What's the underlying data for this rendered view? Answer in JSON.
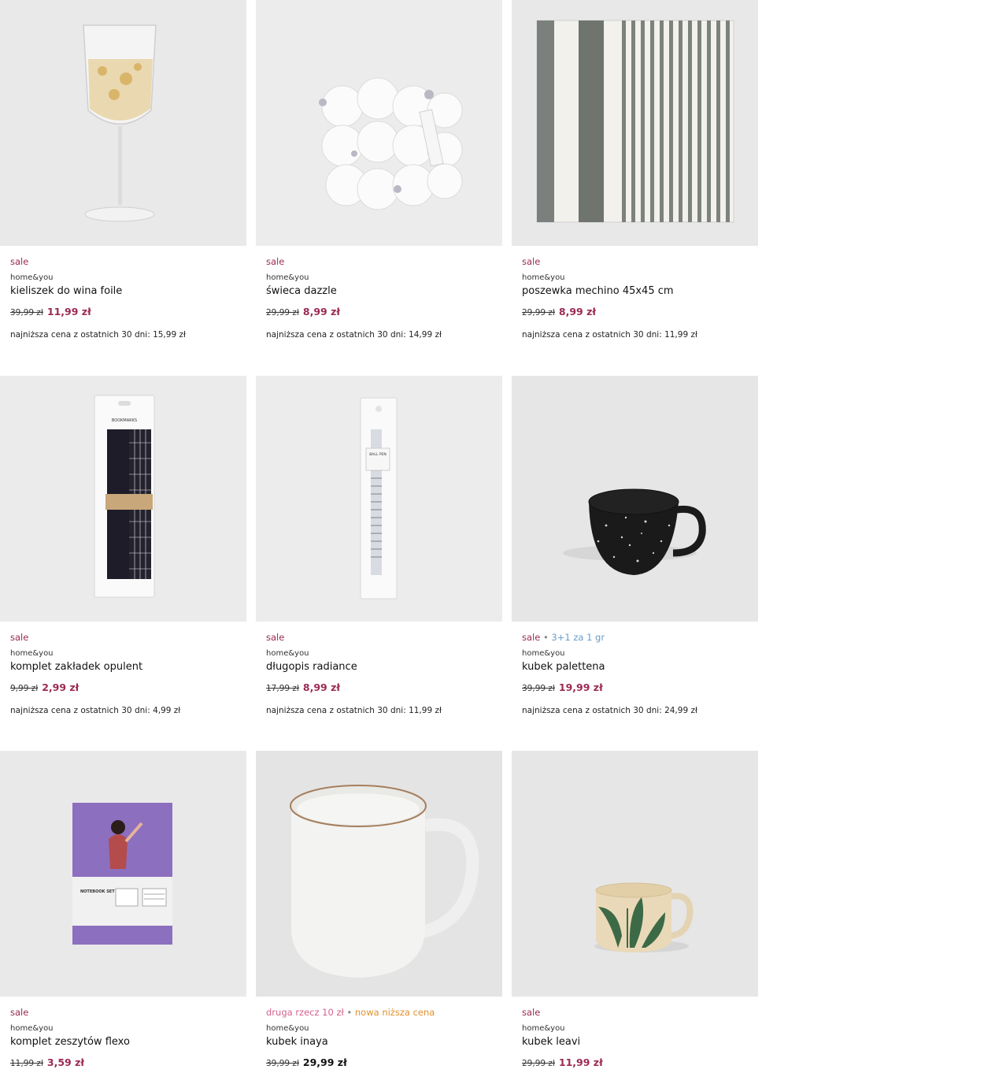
{
  "colors": {
    "sale": "#9b2a54",
    "blue_tag": "#6a9ec9",
    "pink_tag": "#d4628e",
    "orange_tag": "#e0902e",
    "image_bg": "#e9e9e9"
  },
  "products": [
    {
      "tags": [
        "sale"
      ],
      "brand": "home&you",
      "name": "kieliszek do wina foile",
      "old_price": "39,99 zł",
      "price": "11,99 zł",
      "lowest": "najniższa cena z ostatnich 30 dni: 15,99 zł",
      "icon": "wine-glass-image"
    },
    {
      "tags": [
        "sale"
      ],
      "brand": "home&you",
      "name": "świeca dazzle",
      "old_price": "29,99 zł",
      "price": "8,99 zł",
      "lowest": "najniższa cena z ostatnich 30 dni: 14,99 zł",
      "icon": "candle-image"
    },
    {
      "tags": [
        "sale"
      ],
      "brand": "home&you",
      "name": "poszewka mechino 45x45 cm",
      "old_price": "29,99 zł",
      "price": "8,99 zł",
      "lowest": "najniższa cena z ostatnich 30 dni: 11,99 zł",
      "icon": "pillowcase-image"
    },
    {
      "tags": [
        "sale"
      ],
      "brand": "home&you",
      "name": "komplet zakładek opulent",
      "old_price": "9,99 zł",
      "price": "2,99 zł",
      "lowest": "najniższa cena z ostatnich 30 dni: 4,99 zł",
      "icon": "bookmarks-image",
      "package_label": "BOOKMARKS"
    },
    {
      "tags": [
        "sale"
      ],
      "brand": "home&you",
      "name": "długopis radiance",
      "old_price": "17,99 zł",
      "price": "8,99 zł",
      "lowest": "najniższa cena z ostatnich 30 dni: 11,99 zł",
      "icon": "pen-image",
      "package_label": "BALL PEN"
    },
    {
      "tags": [
        "sale",
        "3+1 za 1 gr"
      ],
      "brand": "home&you",
      "name": "kubek palettena",
      "old_price": "39,99 zł",
      "price": "19,99 zł",
      "lowest": "najniższa cena z ostatnich 30 dni: 24,99 zł",
      "icon": "black-mug-image"
    },
    {
      "tags": [
        "sale"
      ],
      "brand": "home&you",
      "name": "komplet zeszytów flexo",
      "old_price": "11,99 zł",
      "price": "3,59 zł",
      "icon": "notebook-image",
      "package_label": "NOTEBOOK SET"
    },
    {
      "tags": [
        "druga rzecz 10 zł",
        "nowa niższa cena"
      ],
      "brand": "home&you",
      "name": "kubek inaya",
      "old_price": "39,99 zł",
      "price": "29,99 zł",
      "icon": "white-mug-image"
    },
    {
      "tags": [
        "sale"
      ],
      "brand": "home&you",
      "name": "kubek leavi",
      "old_price": "29,99 zł",
      "price": "11,99 zł",
      "icon": "leaf-mug-image"
    }
  ]
}
